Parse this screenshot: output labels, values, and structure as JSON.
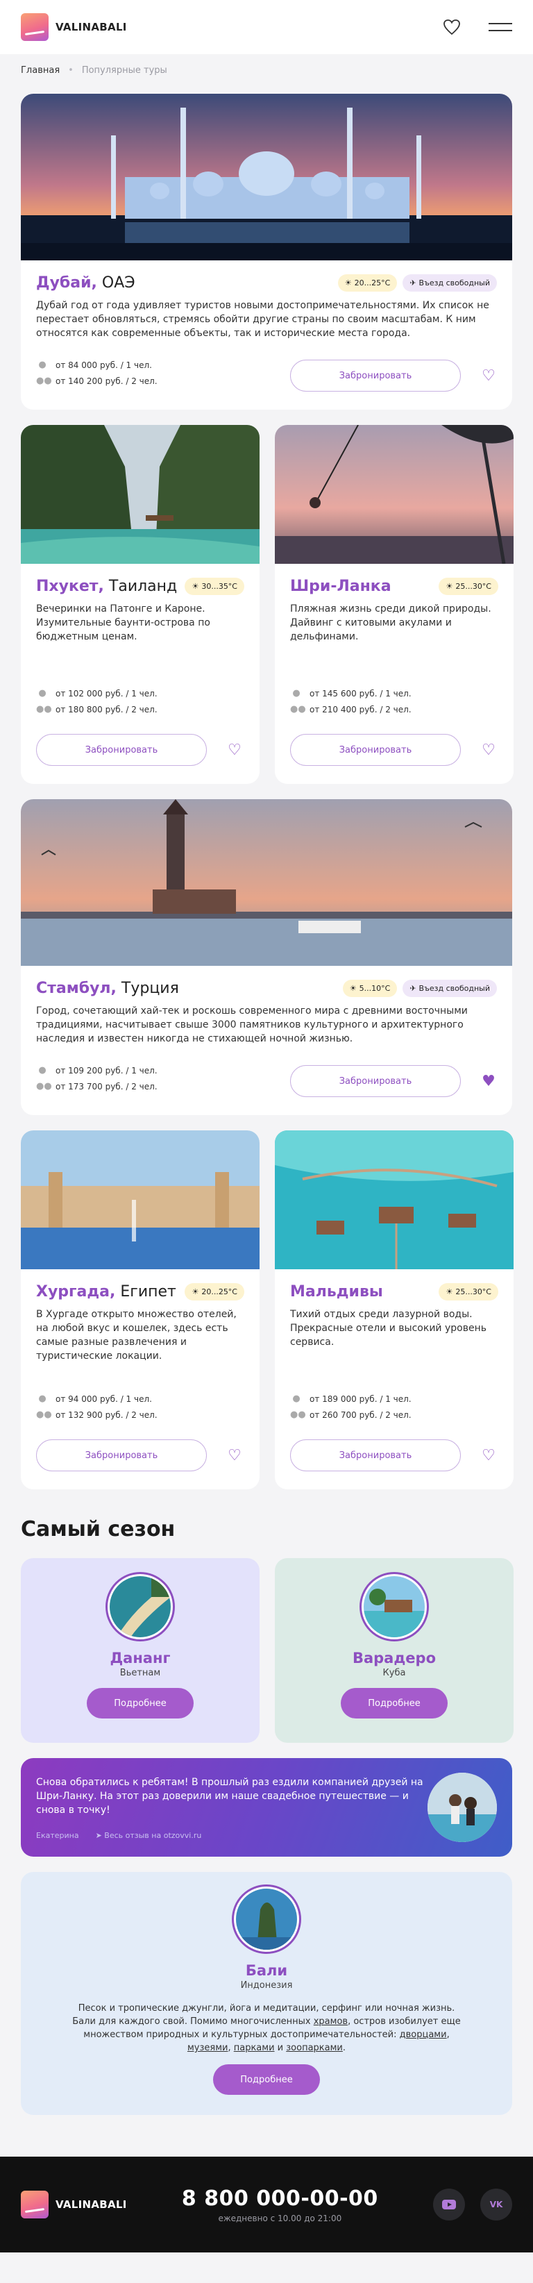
{
  "header": {
    "brand": "VALINABALI"
  },
  "breadcrumbs": {
    "home": "Главная",
    "current": "Популярные туры"
  },
  "tours": {
    "dubai": {
      "city": "Дубай,",
      "country": " ОАЭ",
      "temp": "20...25°C",
      "visa": "Въезд свободный",
      "desc": "Дубай год от года удивляет туристов новыми достопримечательностями. Их список не перестает обновляться, стремясь обойти другие страны по своим масштабам. К ним относятся как современные объекты, так и исторические места города.",
      "price1": "от 84 000 руб. / 1 чел.",
      "price2": "от 140 200 руб. / 2 чел.",
      "btn": "Забронировать"
    },
    "phuket": {
      "city": "Пхукет,",
      "country": " Таиланд",
      "temp": "30...35°C",
      "desc": "Вечеринки на Патонге и Кароне. Изумительные баунти-острова по бюджетным ценам.",
      "price1": "от 102 000 руб. / 1 чел.",
      "price2": "от 180 800 руб. / 2 чел.",
      "btn": "Забронировать"
    },
    "srilanka": {
      "city": "Шри-Ланка",
      "country": "",
      "temp": "25...30°C",
      "desc": "Пляжная жизнь среди дикой природы. Дайвинг с китовыми акулами и дельфинами.",
      "price1": "от 145 600 руб. / 1 чел.",
      "price2": "от 210 400 руб. / 2 чел.",
      "btn": "Забронировать"
    },
    "istanbul": {
      "city": "Стамбул,",
      "country": " Турция",
      "temp": "5...10°C",
      "visa": "Въезд свободный",
      "desc": "Город, сочетающий хай-тек и роскошь современного мира с древними восточными традициями, насчитывает свыше 3000 памятников культурного и архитектурного наследия и известен никогда не стихающей ночной жизнью.",
      "price1": "от 109 200 руб. / 1 чел.",
      "price2": "от 173 700 руб. / 2 чел.",
      "btn": "Забронировать"
    },
    "hurghada": {
      "city": "Хургада,",
      "country": " Египет",
      "temp": "20...25°C",
      "desc": "В Хургаде открыто множество отелей, на любой вкус и кошелек, здесь есть самые разные развлечения и туристические локации.",
      "price1": "от 94 000 руб. / 1 чел.",
      "price2": "от 132 900 руб. / 2 чел.",
      "btn": "Забронировать"
    },
    "maldives": {
      "city": "Мальдивы",
      "country": "",
      "temp": "25...30°C",
      "desc": "Тихий отдых среди лазурной воды. Прекрасные отели и высокий уровень сервиса.",
      "price1": "от 189 000 руб. / 1 чел.",
      "price2": "от 260 700 руб. / 2 чел.",
      "btn": "Забронировать"
    }
  },
  "season": {
    "title": "Самый сезон",
    "danang": {
      "city": "Дананг",
      "country": "Вьетнам",
      "btn": "Подробнее"
    },
    "varadero": {
      "city": "Варадеро",
      "country": "Куба",
      "btn": "Подробнее"
    },
    "review": {
      "text": "Снова обратились к ребятам! В прошлый раз ездили компанией друзей на Шри-Ланку. На этот раз доверили им наше свадебное путешествие — и снова в точку!",
      "author": "Екатерина",
      "source": "Весь отзыв на otzovvi.ru"
    },
    "bali": {
      "city": "Бали",
      "country": "Индонезия",
      "desc_1": "Песок и тропические джунгли, йога и медитации, серфинг или ночная жизнь. Бали для каждого свой. Помимо многочисленных ",
      "link_1": "храмов",
      "desc_2": ", остров изобилует еще множеством природных и культурных достопримечательностей: ",
      "link_2": "дворцами",
      "sep_1": ", ",
      "link_3": "музеями",
      "sep_2": ", ",
      "link_4": "парками",
      "sep_3": " и ",
      "link_5": "зоопарками",
      "desc_end": ".",
      "btn": "Подробнее"
    }
  },
  "footer": {
    "brand": "VALINABALI",
    "phone": "8 800 000-00-00",
    "hours": "ежедневно с 10.00 до 21:00",
    "vk": "VK"
  }
}
